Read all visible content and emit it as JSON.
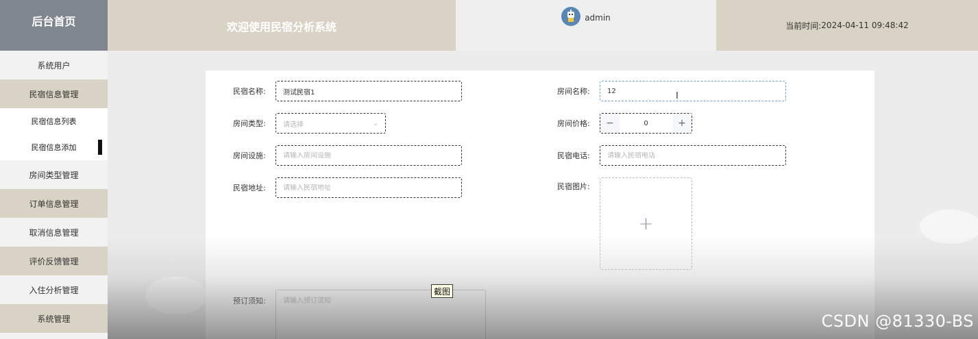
{
  "header": {
    "logo": "后台首页",
    "welcome": "欢迎使用民宿分析系统",
    "user_name": "admin",
    "time_label": "当前时间:",
    "time_value": "2024-04-11 09:48:42"
  },
  "sidebar": {
    "items": [
      {
        "label": "系统用户"
      },
      {
        "label": "民宿信息管理"
      },
      {
        "label": "民宿信息列表"
      },
      {
        "label": "民宿信息添加"
      },
      {
        "label": "房间类型管理"
      },
      {
        "label": "订单信息管理"
      },
      {
        "label": "取消信息管理"
      },
      {
        "label": "评价反馈管理"
      },
      {
        "label": "入住分析管理"
      },
      {
        "label": "系统管理"
      }
    ]
  },
  "form": {
    "homestay_name_label": "民宿名称:",
    "homestay_name_value": "测试民宿1",
    "room_name_label": "房间名称:",
    "room_name_value": "12",
    "room_type_label": "房间类型:",
    "room_type_placeholder": "请选择",
    "room_price_label": "房间价格:",
    "room_price_value": "0",
    "price_minus": "−",
    "price_plus": "+",
    "facilities_label": "房间设施:",
    "facilities_placeholder": "请输入房间设施",
    "phone_label": "民宿电话:",
    "phone_placeholder": "请输入民宿电话",
    "address_label": "民宿地址:",
    "address_placeholder": "请输入民宿地址",
    "image_label": "民宿图片:",
    "upload_plus": "+",
    "notice_label": "预订须知:",
    "notice_placeholder": "请输入预订须知"
  },
  "overlay": {
    "tooltip": "截图",
    "watermark": "CSDN @81330-BS",
    "cursor": "I"
  },
  "colors": {
    "logo_bg": "#7f8690",
    "header_tan": "#d8d3c4",
    "active_indicator": "#111111",
    "focus_border": "#6b9ed1"
  }
}
